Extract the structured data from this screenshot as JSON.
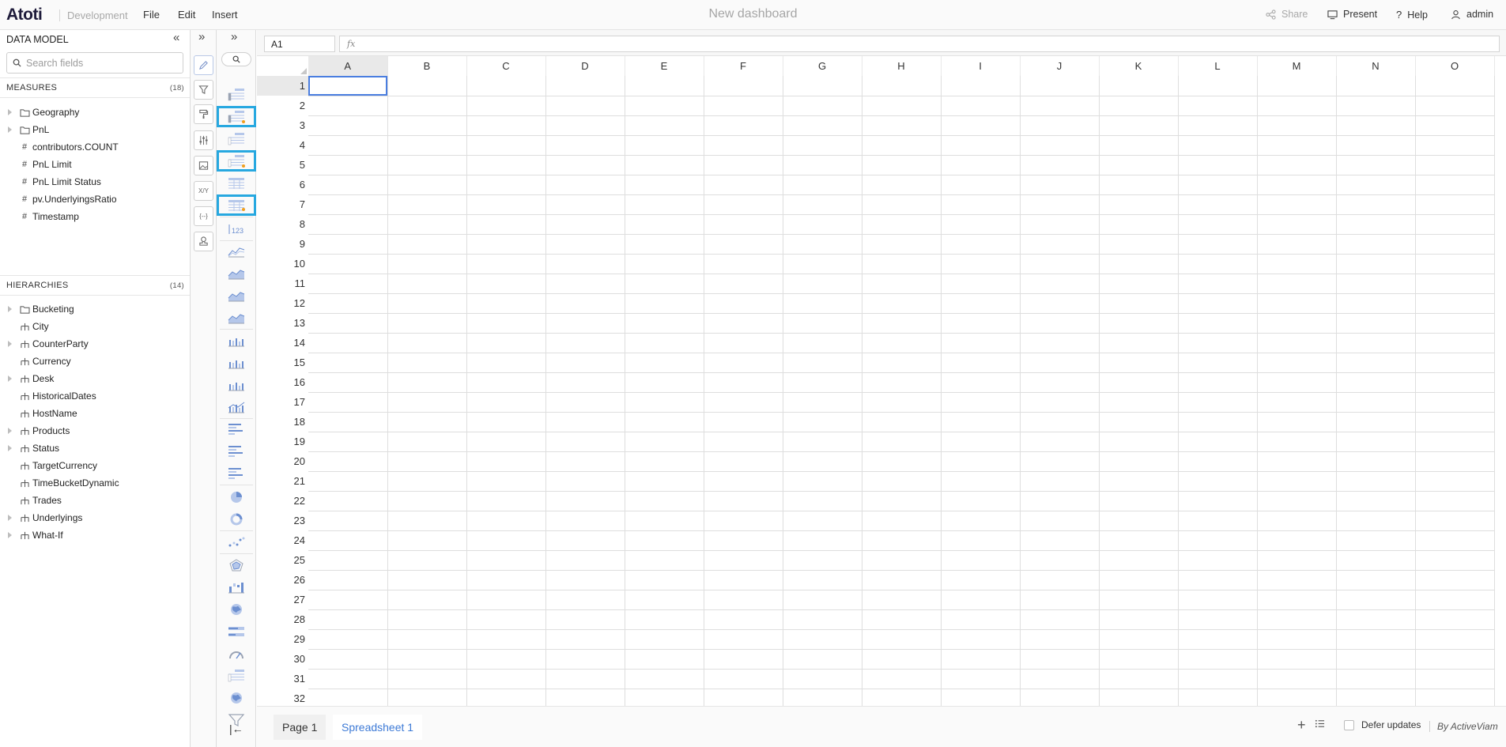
{
  "app": {
    "logo": "Atoti",
    "environment": "Development",
    "menu": [
      "File",
      "Edit",
      "Insert"
    ],
    "dashboard_title": "New dashboard",
    "share_label": "Share",
    "present_label": "Present",
    "help_label": "Help",
    "user_label": "admin"
  },
  "data_model": {
    "title": "DATA MODEL",
    "search_placeholder": "Search fields",
    "measures": {
      "title": "MEASURES",
      "count": "(18)",
      "items": [
        {
          "label": "Geography",
          "type": "folder",
          "expandable": true
        },
        {
          "label": "PnL",
          "type": "folder",
          "expandable": true
        },
        {
          "label": "contributors.COUNT",
          "type": "measure",
          "expandable": false
        },
        {
          "label": "PnL Limit",
          "type": "measure",
          "expandable": false
        },
        {
          "label": "PnL Limit Status",
          "type": "measure",
          "expandable": false
        },
        {
          "label": "pv.UnderlyingsRatio",
          "type": "measure",
          "expandable": false
        },
        {
          "label": "Timestamp",
          "type": "measure",
          "expandable": false
        }
      ]
    },
    "hierarchies": {
      "title": "HIERARCHIES",
      "count": "(14)",
      "items": [
        {
          "label": "Bucketing",
          "type": "folder",
          "expandable": true
        },
        {
          "label": "City",
          "type": "hierarchy",
          "expandable": false
        },
        {
          "label": "CounterParty",
          "type": "hierarchy",
          "expandable": true
        },
        {
          "label": "Currency",
          "type": "hierarchy",
          "expandable": false
        },
        {
          "label": "Desk",
          "type": "hierarchy",
          "expandable": true
        },
        {
          "label": "HistoricalDates",
          "type": "hierarchy",
          "expandable": false
        },
        {
          "label": "HostName",
          "type": "hierarchy",
          "expandable": false
        },
        {
          "label": "Products",
          "type": "hierarchy",
          "expandable": true
        },
        {
          "label": "Status",
          "type": "hierarchy",
          "expandable": true
        },
        {
          "label": "TargetCurrency",
          "type": "hierarchy",
          "expandable": false
        },
        {
          "label": "TimeBucketDynamic",
          "type": "hierarchy",
          "expandable": false
        },
        {
          "label": "Trades",
          "type": "hierarchy",
          "expandable": false
        },
        {
          "label": "Underlyings",
          "type": "hierarchy",
          "expandable": true
        },
        {
          "label": "What-If",
          "type": "hierarchy",
          "expandable": true
        }
      ]
    }
  },
  "tools": [
    {
      "name": "pencil-icon",
      "label": ""
    },
    {
      "name": "filter-icon",
      "label": ""
    },
    {
      "name": "paint-roller-icon",
      "label": ""
    },
    {
      "name": "sliders-icon",
      "label": ""
    },
    {
      "name": "image-icon",
      "label": ""
    },
    {
      "name": "xy-icon",
      "label": "X/Y"
    },
    {
      "name": "braces-icon",
      "label": "{--}"
    },
    {
      "name": "stamp-icon",
      "label": ""
    }
  ],
  "widgets": [
    "pivot-table-icon",
    "pivot-table-alert-icon",
    "tree-table-icon",
    "tree-table-alert-icon",
    "table-icon",
    "table-alert-icon",
    "kpi-icon",
    "line-chart-icon",
    "area-chart-icon",
    "stacked-area-icon",
    "percent-area-icon",
    "column-chart-icon",
    "clustered-column-icon",
    "stacked-column-icon",
    "combo-chart-icon",
    "bar-chart-icon",
    "clustered-bar-icon",
    "stacked-bar-icon",
    "pie-chart-icon",
    "donut-chart-icon",
    "scatter-plot-icon",
    "radar-chart-icon",
    "waterfall-chart-icon",
    "map-icon",
    "bullet-chart-icon",
    "gauge-icon",
    "treemap-icon",
    "globe-icon",
    "funnel-icon"
  ],
  "widgets_highlighted": [
    1,
    3,
    5
  ],
  "formula": {
    "cell_ref": "A1",
    "fx_label": "fx"
  },
  "sheet": {
    "columns": [
      "A",
      "B",
      "C",
      "D",
      "E",
      "F",
      "G",
      "H",
      "I",
      "J",
      "K",
      "L",
      "M",
      "N",
      "O"
    ],
    "rows": [
      "1",
      "2",
      "3",
      "4",
      "5",
      "6",
      "7",
      "8",
      "9",
      "10",
      "11",
      "12",
      "13",
      "14",
      "15",
      "16",
      "17",
      "18",
      "19",
      "20",
      "21",
      "22",
      "23",
      "24",
      "25",
      "26",
      "27",
      "28",
      "29",
      "30",
      "31",
      "32"
    ],
    "selected_col": "A",
    "selected_row": "1"
  },
  "bottom": {
    "pages": [
      "Page 1",
      "Spreadsheet 1"
    ],
    "active_page": "Spreadsheet 1",
    "defer_label": "Defer updates",
    "by_label": "By ActiveViam"
  },
  "colors": {
    "accent": "#3d7ad6",
    "highlight_border": "#27a8e0",
    "active_cell": "#4a7ee0"
  }
}
